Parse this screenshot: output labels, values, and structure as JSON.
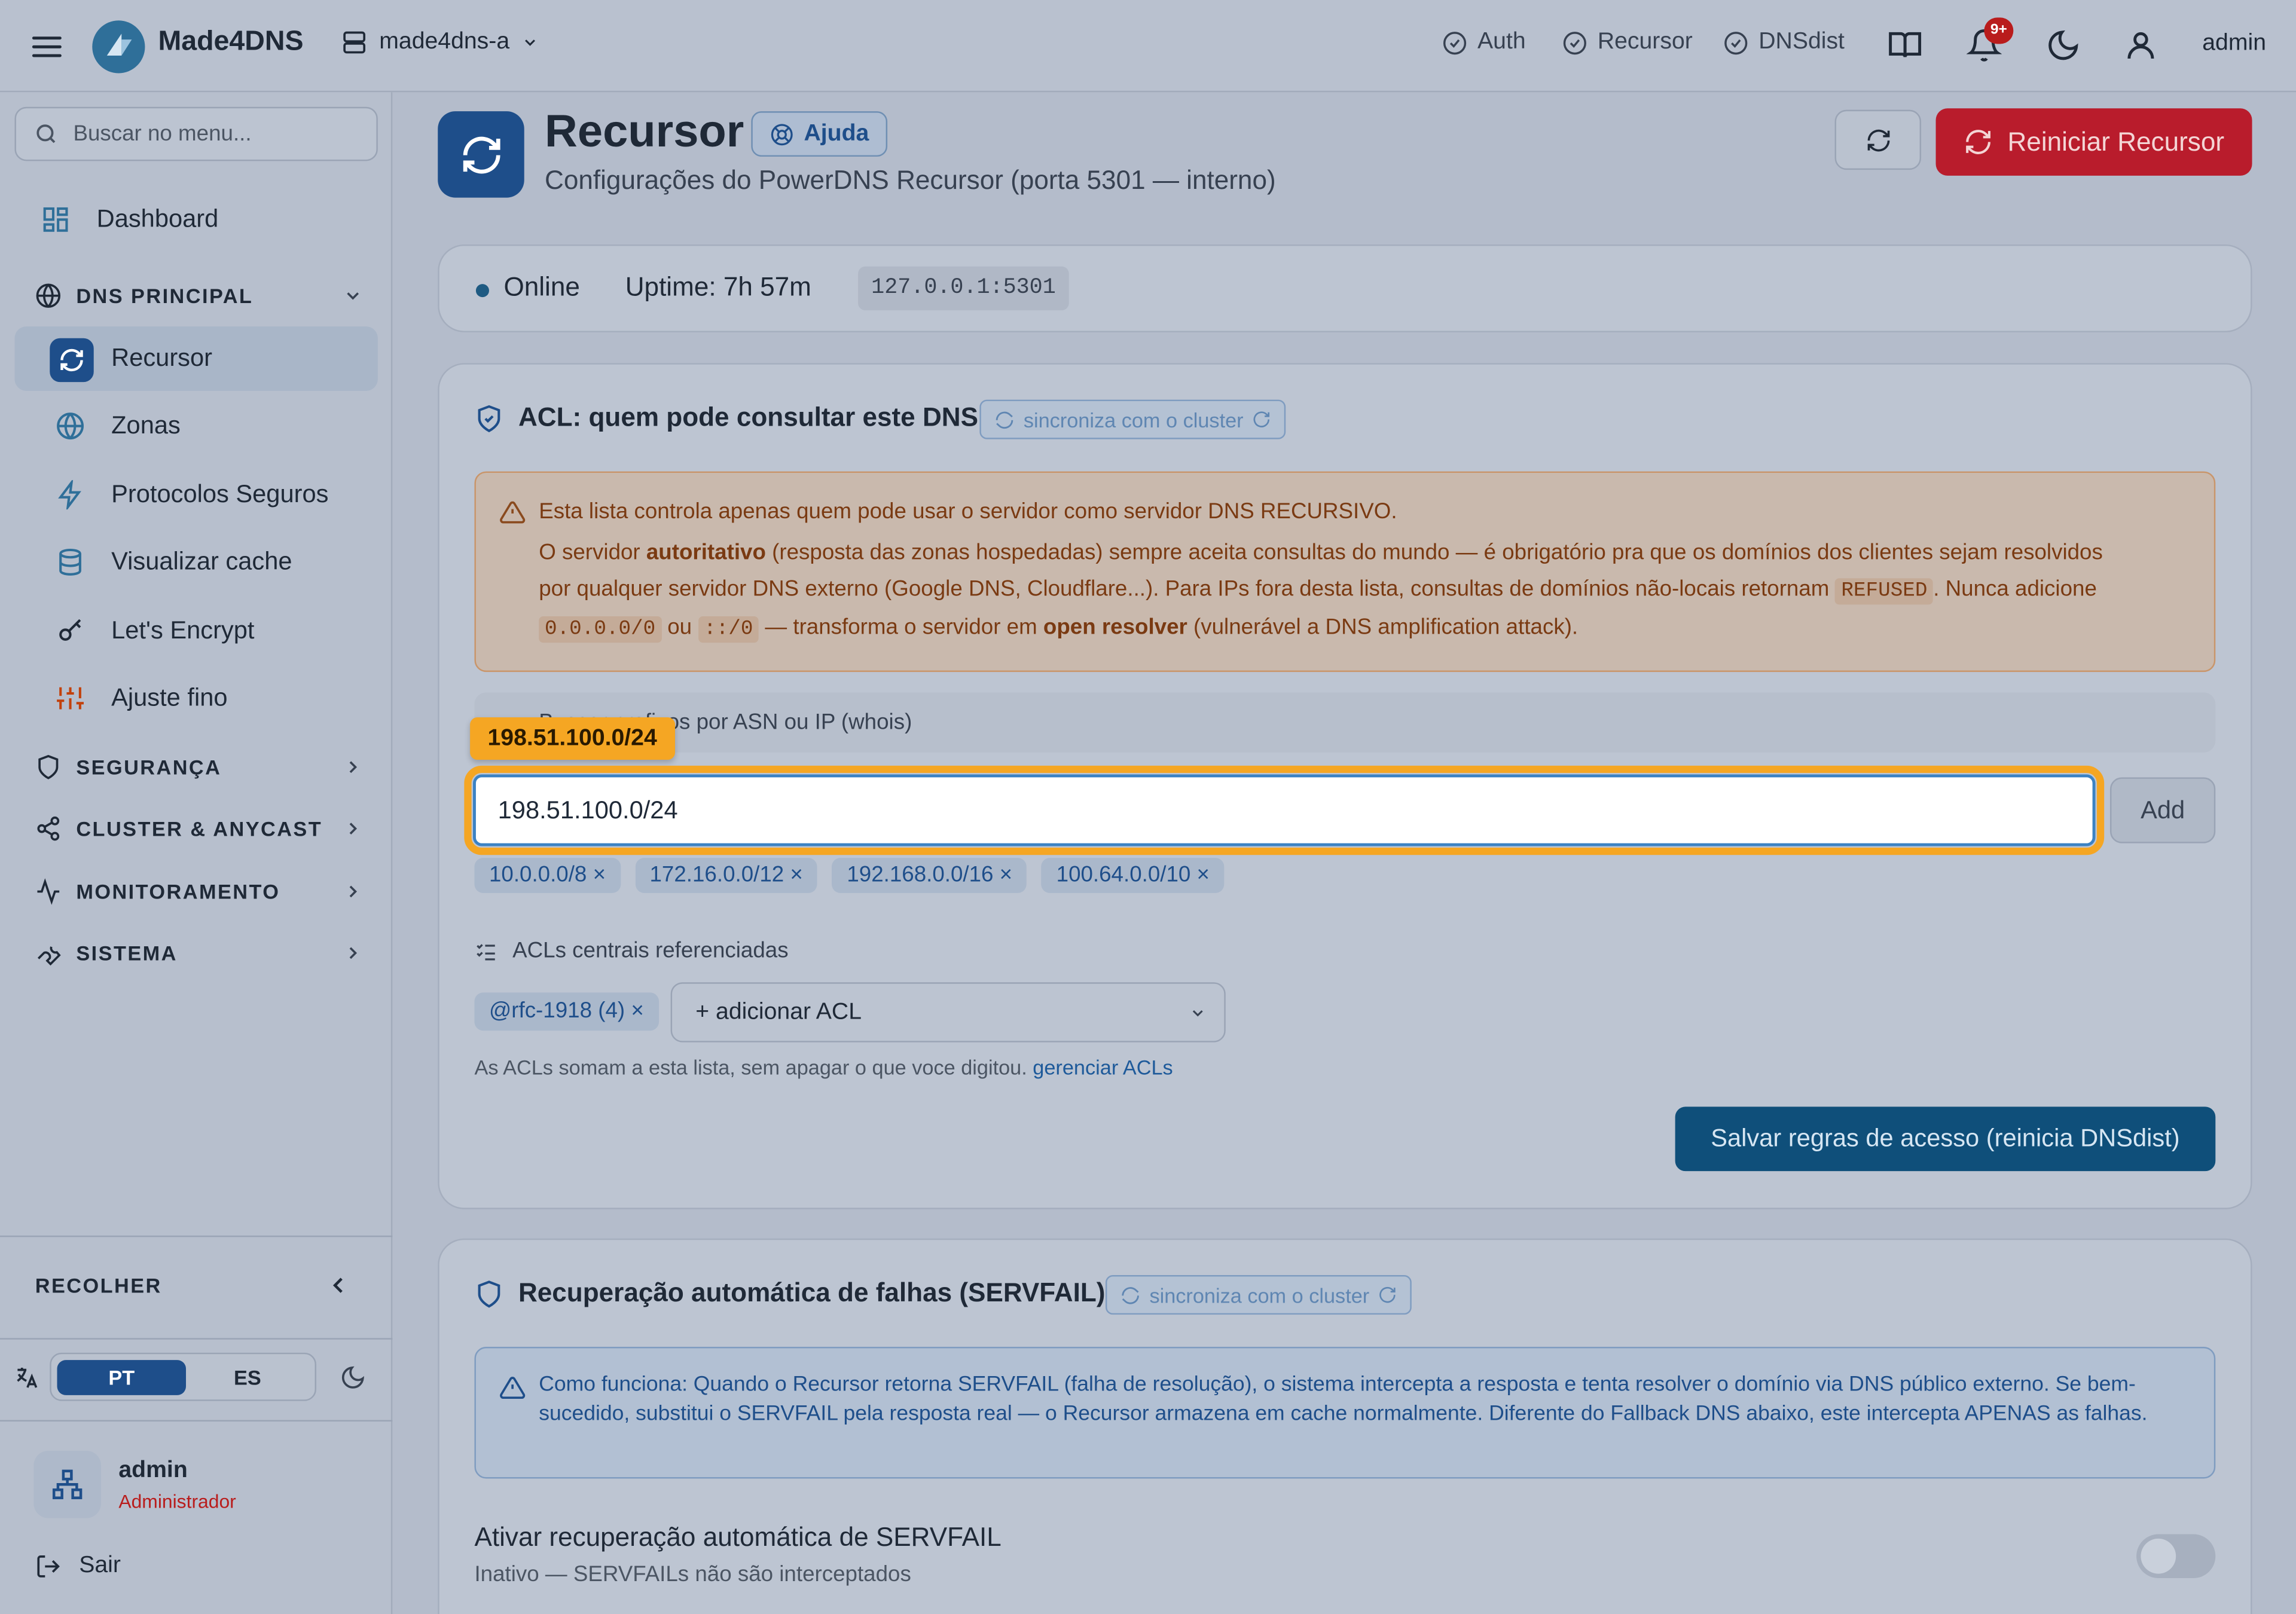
{
  "topbar": {
    "brand": "Made4DNS",
    "server": "made4dns-a",
    "nav": [
      "Auth",
      "Recursor",
      "DNSdist"
    ],
    "notifications_badge": "9+",
    "user": "admin"
  },
  "sidebar": {
    "search_placeholder": "Buscar no menu...",
    "dashboard": "Dashboard",
    "section_dns": "DNS PRINCIPAL",
    "items": [
      "Recursor",
      "Zonas",
      "Protocolos Seguros",
      "Visualizar cache",
      "Let's Encrypt",
      "Ajuste fino"
    ],
    "sections": [
      "SEGURANÇA",
      "CLUSTER & ANYCAST",
      "MONITORAMENTO",
      "SISTEMA"
    ],
    "collapse": "RECOLHER",
    "lang_pt": "PT",
    "lang_es": "ES",
    "user_name": "admin",
    "user_role": "Administrador",
    "logout": "Sair"
  },
  "page": {
    "title": "Recursor",
    "help": "Ajuda",
    "subtitle": "Configurações do PowerDNS Recursor (porta 5301 — interno)",
    "restart": "Reiniciar Recursor"
  },
  "status": {
    "state": "Online",
    "uptime": "Uptime: 7h 57m",
    "address": "127.0.0.1:5301"
  },
  "acl": {
    "title": "ACL: quem pode consultar este DNS",
    "sync": "sincroniza com o cluster",
    "warn_line1": "Esta lista controla apenas quem pode usar o servidor como servidor DNS RECURSIVO.",
    "warn_p1": "O servidor ",
    "warn_b1": "autoritativo",
    "warn_p2": " (resposta das zonas hospedadas) sempre aceita consultas do mundo — é obrigatório pra que os domínios dos clientes sejam resolvidos",
    "warn_p3": "por qualquer servidor DNS externo (Google DNS, Cloudflare...). Para IPs fora desta lista, consultas de domínios não-locais retornam ",
    "warn_code1": "REFUSED",
    "warn_p4": ". Nunca adicione",
    "warn_code2": "0.0.0.0/0",
    "warn_p5": " ou ",
    "warn_code3": "::/0",
    "warn_p6": " — transforma o servidor em ",
    "warn_b2": "open resolver",
    "warn_p7": " (vulnerável a DNS amplification attack).",
    "whois": "Buscar prefixos por ASN ou IP (whois)",
    "tooltip": "198.51.100.0/24",
    "input_value": "198.51.100.0/24",
    "add": "Add",
    "chips": [
      "10.0.0.0/8 ×",
      "172.16.0.0/12 ×",
      "192.168.0.0/16 ×",
      "100.64.0.0/10 ×"
    ],
    "ref_header": "ACLs centrais referenciadas",
    "ref_chip": "@rfc-1918 (4) ×",
    "ref_select": "+ adicionar ACL",
    "note": "As ACLs somam a esta lista, sem apagar o que voce digitou. ",
    "note_link": "gerenciar ACLs",
    "save": "Salvar regras de acesso (reinicia DNSdist)"
  },
  "servfail": {
    "title": "Recuperação automática de falhas (SERVFAIL)",
    "sync": "sincroniza com o cluster",
    "info": "Como funciona: Quando o Recursor retorna SERVFAIL (falha de resolução), o sistema intercepta a resposta e tenta resolver o domínio via DNS público externo. Se bem-sucedido, substitui o SERVFAIL pela resposta real — o Recursor armazena em cache normalmente. Diferente do Fallback DNS abaixo, este intercepta APENAS as falhas.",
    "toggle_label": "Ativar recuperação automática de SERVFAIL",
    "toggle_sub": "Inativo — SERVFAILs não são interceptados",
    "enabled": false
  }
}
